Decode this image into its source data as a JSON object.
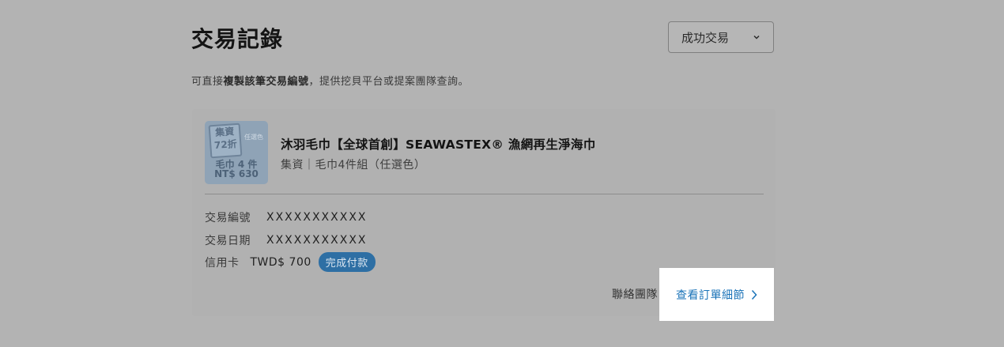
{
  "header": {
    "title": "交易記錄"
  },
  "filter": {
    "selected": "成功交易"
  },
  "hint": {
    "prefix": "可直接",
    "bold": "複製該筆交易編號",
    "suffix": "，提供挖貝平台或提案團隊查詢。"
  },
  "order": {
    "thumbnail": {
      "stamp_line1": "集資",
      "stamp_line2": "72折",
      "option_text": "任選色",
      "line1": "毛巾 4 件",
      "line2": "NT$ 630"
    },
    "product_title": "沐羽毛巾【全球首創】SEAWASTEX® 漁網再生淨海巾",
    "product_subtitle": "集資｜毛巾4件組（任選色）",
    "transaction_id_label": "交易編號",
    "transaction_id_value": "XXXXXXXXXXX",
    "transaction_date_label": "交易日期",
    "transaction_date_value": "XXXXXXXXXXX",
    "payment_label": "信用卡",
    "amount": "TWD$ 700",
    "status_badge": "完成付款",
    "contact_link": "聯絡團隊",
    "detail_button": "查看訂單細節"
  },
  "colors": {
    "link": "#1a73b8",
    "badge": "#2e6fa4",
    "overlay": "#b3b3b3"
  }
}
